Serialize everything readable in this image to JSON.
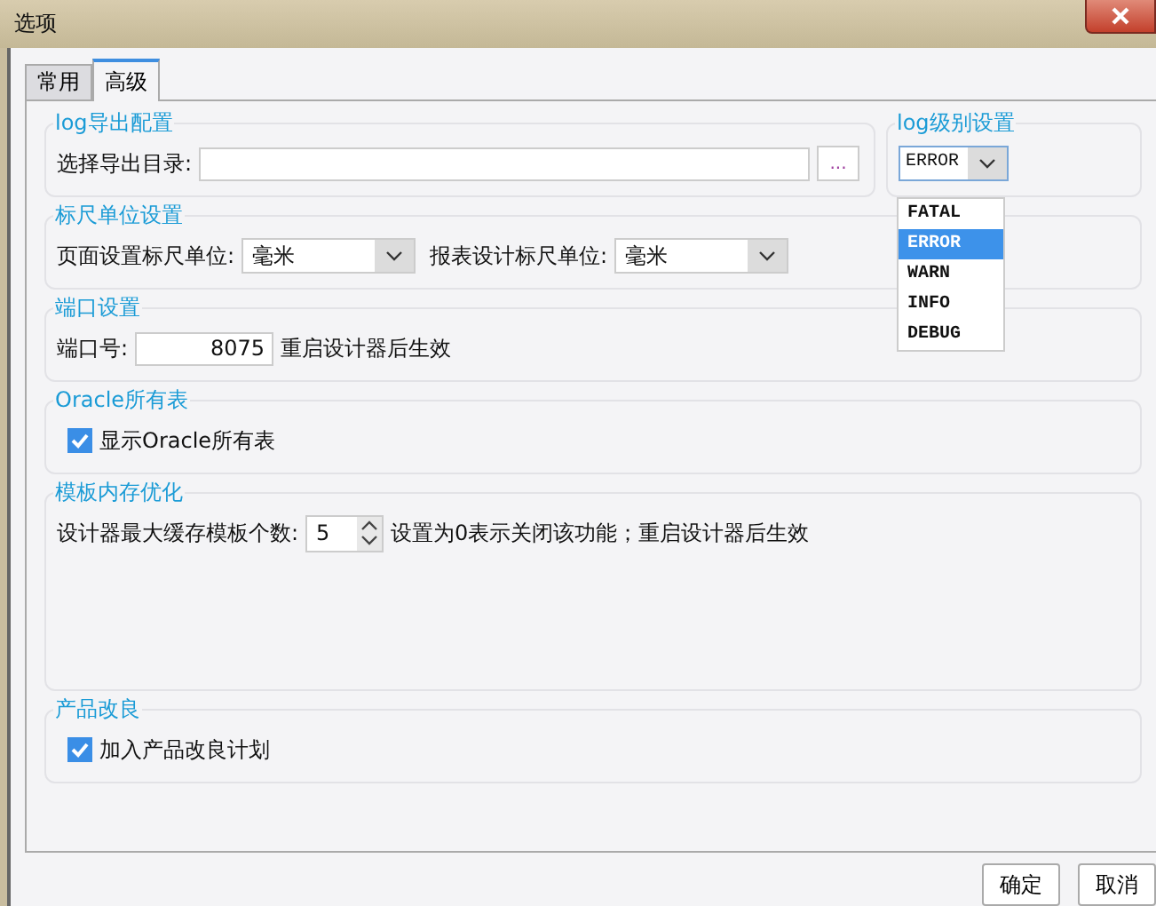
{
  "window": {
    "title": "选项"
  },
  "tabs": [
    {
      "label": "常用",
      "selected": false
    },
    {
      "label": "高级",
      "selected": true
    }
  ],
  "log_export": {
    "title": "log导出配置",
    "label": "选择导出目录:",
    "browse": "..."
  },
  "log_level": {
    "title": "log级别设置",
    "value": "ERROR",
    "expanded": true,
    "options": [
      {
        "label": "FATAL",
        "selected": false
      },
      {
        "label": "ERROR",
        "selected": true
      },
      {
        "label": "WARN",
        "selected": false
      },
      {
        "label": "INFO",
        "selected": false
      },
      {
        "label": "DEBUG",
        "selected": false
      }
    ]
  },
  "ruler": {
    "title": "标尺单位设置",
    "fields": [
      {
        "label": "页面设置标尺单位:",
        "value": "毫米"
      },
      {
        "label": "报表设计标尺单位:",
        "value": "毫米"
      }
    ]
  },
  "port": {
    "title": "端口设置",
    "label": "端口号:",
    "value": "8075",
    "note": "重启设计器后生效"
  },
  "oracle": {
    "title": "Oracle所有表",
    "checkbox": {
      "label": "显示Oracle所有表",
      "checked": true
    }
  },
  "template_cache": {
    "title": "模板内存优化",
    "label": "设计器最大缓存模板个数:",
    "value": "5",
    "note": "设置为0表示关闭该功能；重启设计器后生效"
  },
  "improvement": {
    "title": "产品改良",
    "checkbox": {
      "label": "加入产品改良计划",
      "checked": true
    }
  },
  "buttons": [
    "确定",
    "取消"
  ]
}
